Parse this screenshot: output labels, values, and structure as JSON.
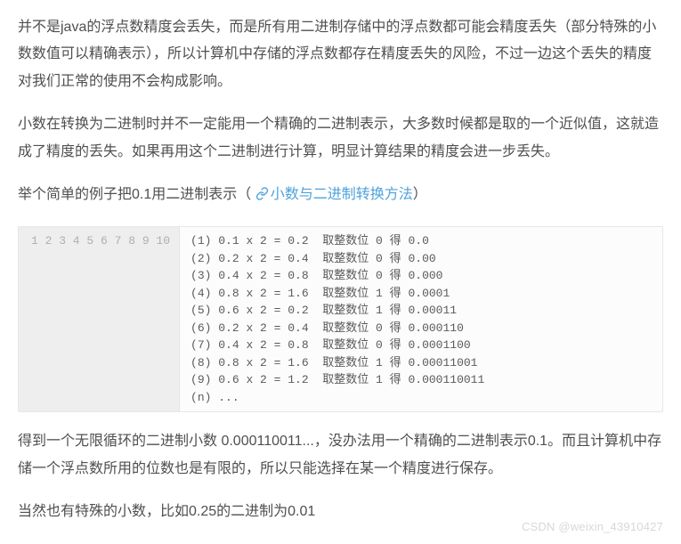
{
  "paragraphs": {
    "p1": "并不是java的浮点数精度会丢失，而是所有用二进制存储中的浮点数都可能会精度丢失（部分特殊的小数数值可以精确表示），所以计算机中存储的浮点数都存在精度丢失的风险，不过一边这个丢失的精度对我们正常的使用不会构成影响。",
    "p2": "小数在转换为二进制时并不一定能用一个精确的二进制表示，大多数时候都是取的一个近似值，这就造成了精度的丢失。如果再用这个二进制进行计算，明显计算结果的精度会进一步丢失。",
    "p3_prefix": "举个简单的例子把0.1用二进制表示（",
    "p3_link": "小数与二进制转换方法",
    "p3_suffix": "）",
    "p4": "得到一个无限循环的二进制小数 0.000110011...，没办法用一个精确的二进制表示0.1。而且计算机中存储一个浮点数所用的位数也是有限的，所以只能选择在某一个精度进行保存。",
    "p5": "当然也有特殊的小数，比如0.25的二进制为0.01"
  },
  "code": {
    "gutter": "1\n2\n3\n4\n5\n6\n7\n8\n9\n10",
    "lines": "(1) 0.1 x 2 = 0.2  取整数位 0 得 0.0\n(2) 0.2 x 2 = 0.4  取整数位 0 得 0.00\n(3) 0.4 x 2 = 0.8  取整数位 0 得 0.000\n(4) 0.8 x 2 = 1.6  取整数位 1 得 0.0001\n(5) 0.6 x 2 = 0.2  取整数位 1 得 0.00011\n(6) 0.2 x 2 = 0.4  取整数位 0 得 0.000110\n(7) 0.4 x 2 = 0.8  取整数位 0 得 0.0001100\n(8) 0.8 x 2 = 1.6  取整数位 1 得 0.00011001\n(9) 0.6 x 2 = 1.2  取整数位 1 得 0.000110011\n(n) ..."
  },
  "watermark": "CSDN @weixin_43910427"
}
